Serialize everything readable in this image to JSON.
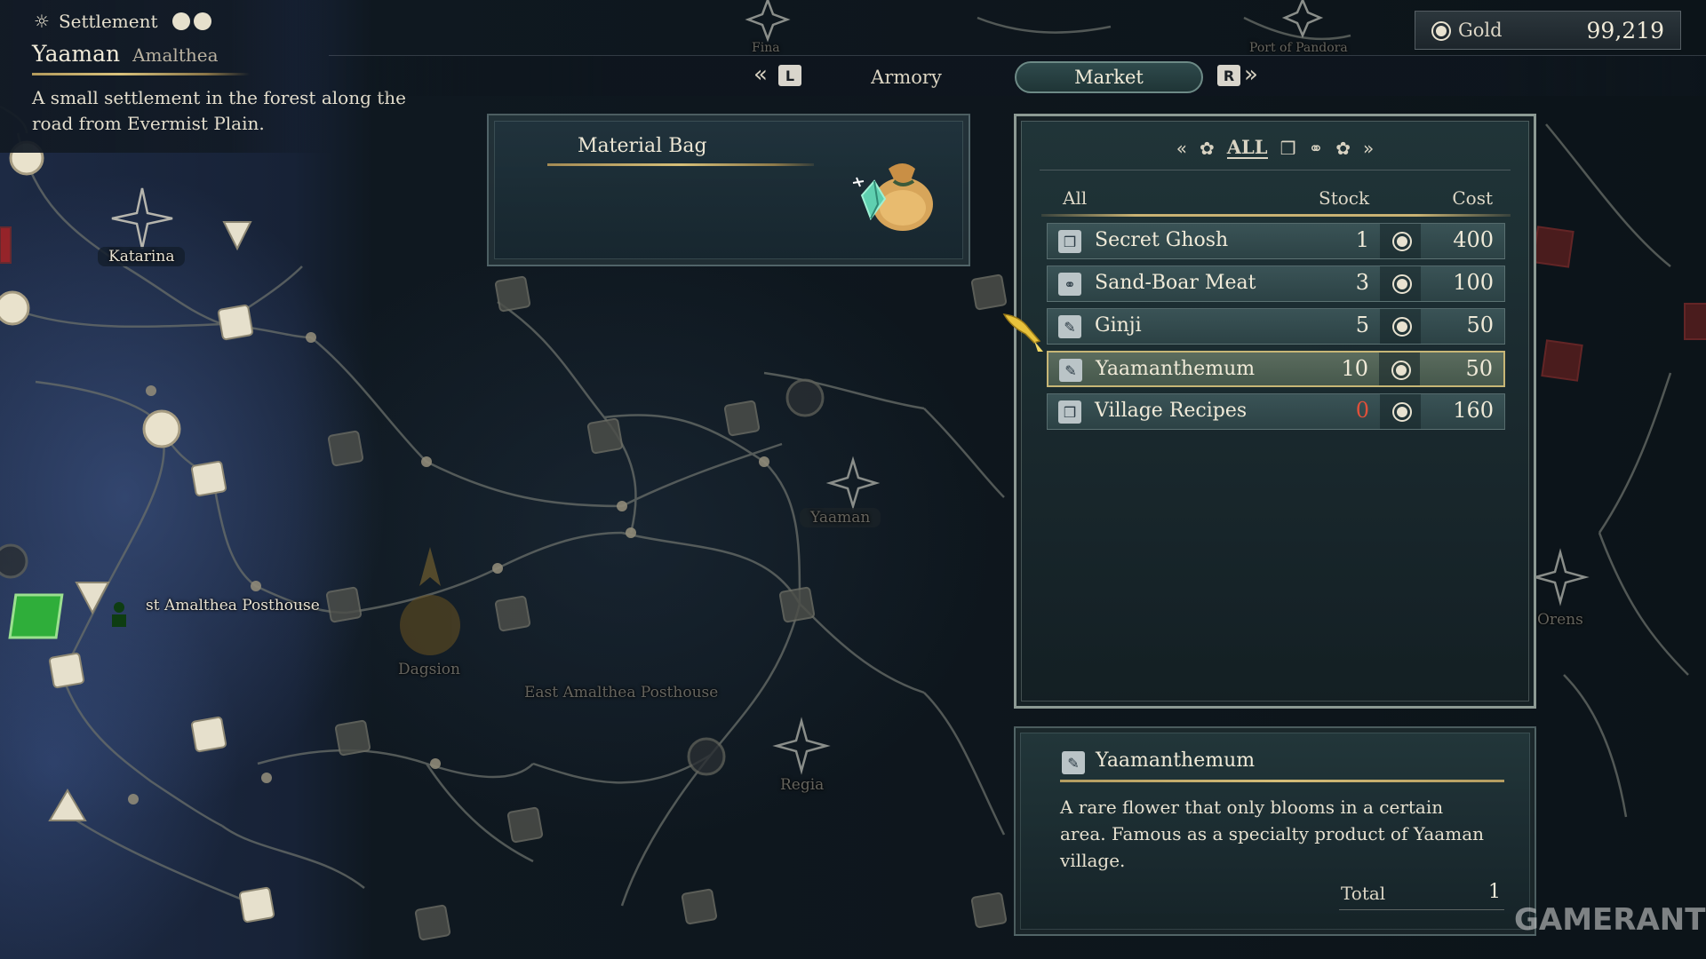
{
  "settlement": {
    "type_label": "Settlement",
    "name": "Yaaman",
    "region": "Amalthea",
    "description": "A small settlement in the forest along the road from Evermist Plain."
  },
  "tabs": {
    "left_button": "L",
    "right_button": "R",
    "items": [
      {
        "label": "Armory",
        "active": false
      },
      {
        "label": "Market",
        "active": true
      }
    ]
  },
  "gold": {
    "label": "Gold",
    "value": "99,219"
  },
  "material_bag": {
    "title": "Material Bag",
    "icon": "material-bag-icon"
  },
  "market": {
    "category_filter": "ALL",
    "columns": {
      "name": "All",
      "stock": "Stock",
      "cost": "Cost"
    },
    "items": [
      {
        "name": "Secret Ghosh",
        "stock": "1",
        "cost": "400",
        "icon": "gift-icon",
        "selected": false
      },
      {
        "name": "Sand-Boar Meat",
        "stock": "3",
        "cost": "100",
        "icon": "ring-icon",
        "selected": false
      },
      {
        "name": "Ginji",
        "stock": "5",
        "cost": "50",
        "icon": "herb-icon",
        "selected": false
      },
      {
        "name": "Yaamanthemum",
        "stock": "10",
        "cost": "50",
        "icon": "herb-icon",
        "selected": true
      },
      {
        "name": "Village Recipes",
        "stock": "0",
        "cost": "160",
        "icon": "gift-icon",
        "selected": false
      }
    ]
  },
  "detail": {
    "name": "Yaamanthemum",
    "icon": "herb-icon",
    "description": "A rare flower that only blooms in a certain area. Famous as a specialty product of Yaaman village.",
    "total_label": "Total",
    "total_value": "1"
  },
  "map": {
    "labels": [
      "Katarina",
      "st Amalthea Posthouse",
      "Dagsion",
      "East Amalthea Posthouse",
      "Yaaman",
      "Regia",
      "Orens",
      "Port of Pandora",
      "Fina"
    ]
  },
  "watermark": "GAMERANT",
  "colors": {
    "accent_gold": "#c9b273",
    "selected_row": "#5b6c5e",
    "zero_stock": "#e0503a",
    "player_marker": "#2fae3a"
  }
}
